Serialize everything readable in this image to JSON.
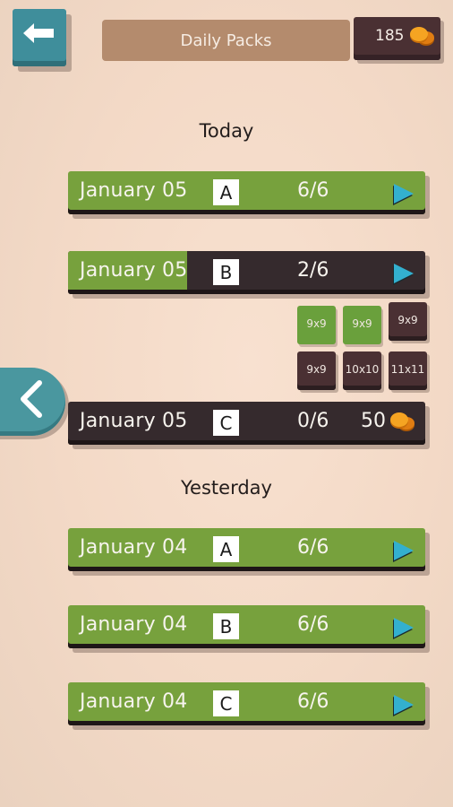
{
  "header": {
    "back_icon": "arrow-left-icon",
    "title": "Daily Packs",
    "coins": "185",
    "coin_icon": "coin-stack-icon"
  },
  "colors": {
    "solved": "#77a13d",
    "unsolved": "#352a2d",
    "accent": "#33b0cf",
    "teal_button": "#3f8e9b",
    "title_bar": "#b48b6d",
    "coin": "#f5a422"
  },
  "sections": [
    {
      "title": "Today",
      "packs": [
        {
          "date": "January 05",
          "letter": "A",
          "count": "6/6",
          "progress": 1.0,
          "action": "play"
        },
        {
          "date": "January 05",
          "letter": "B",
          "count": "2/6",
          "progress": 0.333,
          "action": "play"
        },
        {
          "date": "January 05",
          "letter": "C",
          "count": "0/6",
          "progress": 0,
          "action": "unlock",
          "cost": "50"
        }
      ]
    },
    {
      "title": "Yesterday",
      "packs": [
        {
          "date": "January 04",
          "letter": "A",
          "count": "6/6",
          "progress": 1.0,
          "action": "play"
        },
        {
          "date": "January 04",
          "letter": "B",
          "count": "6/6",
          "progress": 1.0,
          "action": "play"
        },
        {
          "date": "January 04",
          "letter": "C",
          "count": "6/6",
          "progress": 1.0,
          "action": "play"
        }
      ]
    }
  ],
  "expanded_pack_levels": [
    {
      "size": "9x9",
      "solved": true
    },
    {
      "size": "9x9",
      "solved": true
    },
    {
      "size": "9x9",
      "solved": false
    },
    {
      "size": "9x9",
      "solved": false
    },
    {
      "size": "10x10",
      "solved": false
    },
    {
      "size": "11x11",
      "solved": false
    }
  ],
  "side_nav": {
    "icon": "chevron-left-icon"
  }
}
